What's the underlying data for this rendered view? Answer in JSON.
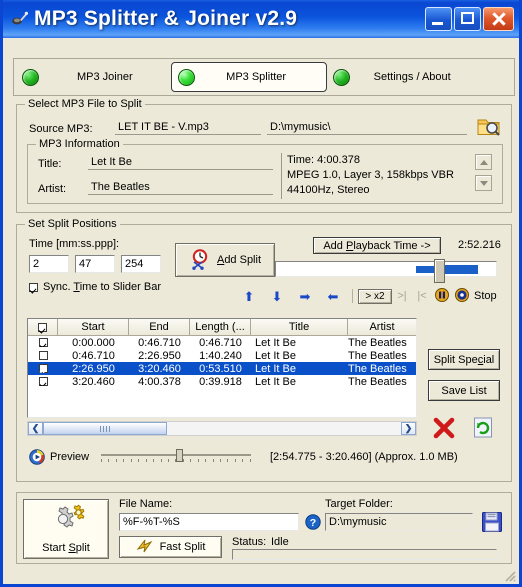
{
  "window": {
    "title": "MP3 Splitter & Joiner v2.9",
    "app_icon": "mp3-app-icon",
    "minimize": "minimize-icon",
    "maximize": "maximize-icon",
    "close": "close-icon"
  },
  "tabs": [
    {
      "label": "MP3 Joiner",
      "selected": false
    },
    {
      "label": "MP3 Splitter",
      "selected": true
    },
    {
      "label": "Settings / About",
      "selected": false
    }
  ],
  "select_file": {
    "group_title": "Select MP3 File to Split",
    "source_label": "Source MP3:",
    "source_file": "LET IT BE - V.mp3",
    "source_folder": "D:\\mymusic\\",
    "browse_icon": "folder-search-icon",
    "info": {
      "group_title": "MP3 Information",
      "title_label": "Title:",
      "title_value": "Let It Be",
      "artist_label": "Artist:",
      "artist_value": "The Beatles",
      "details": [
        "Time: 4:00.378",
        "MPEG 1.0, Layer 3, 158kbps VBR",
        "44100Hz, Stereo"
      ],
      "scroll_up_icon": "chevron-up-icon",
      "scroll_down_icon": "chevron-down-icon"
    }
  },
  "split_positions": {
    "group_title": "Set Split Positions",
    "time_label": "Time [mm:ss.ppp]:",
    "time_mm": "2",
    "time_ss": "47",
    "time_ppp": "254",
    "add_split_label": "Add Split",
    "add_split_icon": "clock-scissors-icon",
    "sync_checkbox_label": "Sync. Time to Slider Bar",
    "sync_checked": true,
    "add_playback_time_label": "Add Playback Time ->",
    "playback_time": "2:52.216",
    "slider_percent": 72,
    "transport": {
      "icons": [
        "arrow-up-icon",
        "arrow-down-icon",
        "arrow-right-stack-icon",
        "arrow-left-stack-icon"
      ],
      "speed_label": "> x2",
      "next_label": ">|",
      "prev_label": "|<",
      "pause_icon": "pause-icon",
      "play_icon": "play-record-icon",
      "stop_label": "Stop"
    }
  },
  "table": {
    "headers": [
      "",
      "Start",
      "End",
      "Length (...",
      "Title",
      "Artist"
    ],
    "rows": [
      {
        "checked": true,
        "selected": false,
        "start": "0:00.000",
        "end": "0:46.710",
        "length": "0:46.710",
        "title": "Let It Be",
        "artist": "The Beatles"
      },
      {
        "checked": false,
        "selected": false,
        "start": "0:46.710",
        "end": "2:26.950",
        "length": "1:40.240",
        "title": "Let It Be",
        "artist": "The Beatles"
      },
      {
        "checked": true,
        "selected": true,
        "start": "2:26.950",
        "end": "3:20.460",
        "length": "0:53.510",
        "title": "Let It Be",
        "artist": "The Beatles"
      },
      {
        "checked": true,
        "selected": false,
        "start": "3:20.460",
        "end": "4:00.378",
        "length": "0:39.918",
        "title": "Let It Be",
        "artist": "The Beatles"
      }
    ],
    "header_checkbox_checked": true,
    "scroll_left_icon": "chevron-left-icon",
    "scroll_right_icon": "chevron-right-icon"
  },
  "side_buttons": {
    "split_special": "Split Special",
    "save_list": "Save List",
    "delete_icon": "red-x-delete-icon",
    "refresh_icon": "refresh-page-icon"
  },
  "preview": {
    "icon": "play-preview-icon",
    "label": "Preview",
    "range_text": "[2:54.775 - 3:20.460] (Approx. 1.0 MB)",
    "slider_percent": 52
  },
  "output": {
    "start_split_label": "Start Split",
    "start_split_icon": "gears-icon",
    "file_name_label": "File Name:",
    "file_name_value": "%F-%T-%S",
    "help_icon": "help-question-icon",
    "target_folder_label": "Target Folder:",
    "target_folder_value": "D:\\mymusic",
    "save_icon": "floppy-save-icon",
    "fast_split_label": "Fast Split",
    "fast_split_icon": "lightning-icon",
    "status_label": "Status:",
    "status_value": "Idle"
  },
  "colors": {
    "titlebar_blue": "#0a46d2",
    "face": "#ece9d8",
    "selection_blue": "#0a50c8",
    "led_green": "#22b822",
    "accent_red": "#c33a15"
  }
}
